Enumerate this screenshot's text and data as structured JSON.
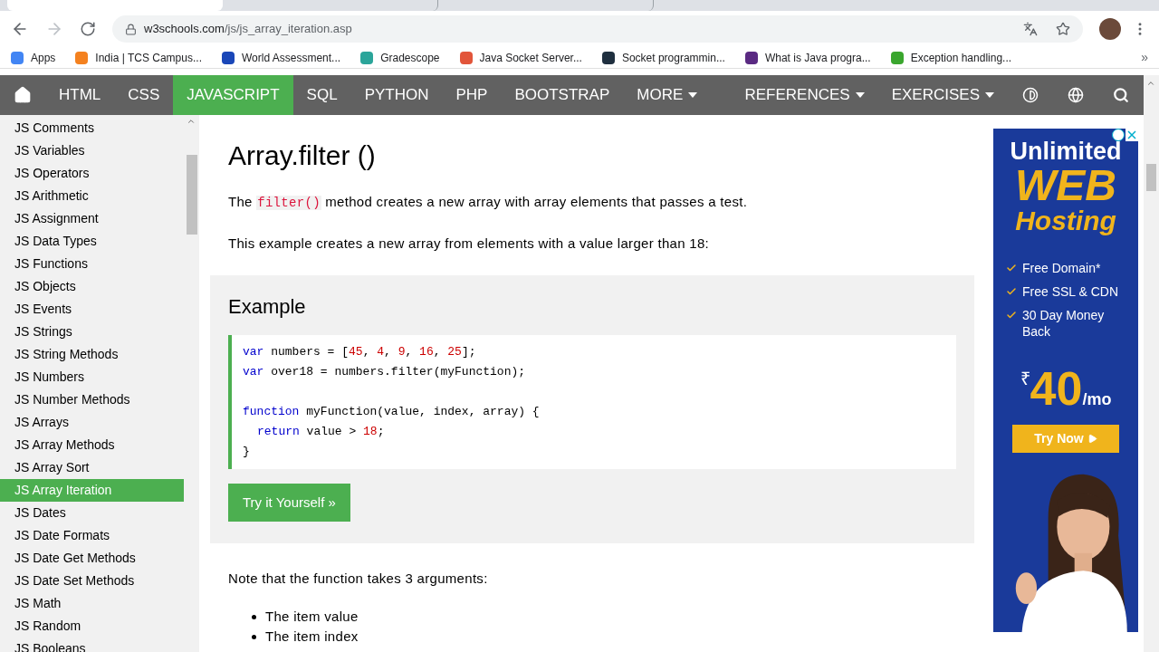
{
  "browser": {
    "tabs": [
      {
        "selected": true
      },
      {
        "selected": false
      },
      {
        "selected": false
      }
    ],
    "url_host": "w3schools.com",
    "url_path": "/js/js_array_iteration.asp",
    "bookmarks": [
      {
        "label": "Apps",
        "color": "#4285f4"
      },
      {
        "label": "India | TCS Campus...",
        "color": "#f4811f"
      },
      {
        "label": "World Assessment...",
        "color": "#1a47b8"
      },
      {
        "label": "Gradescope",
        "color": "#2ba59a"
      },
      {
        "label": "Java Socket Server...",
        "color": "#e2553a"
      },
      {
        "label": "Socket programmin...",
        "color": "#1f2f3f"
      },
      {
        "label": "What is Java progra...",
        "color": "#5a2a82"
      },
      {
        "label": "Exception handling...",
        "color": "#3aa62e"
      }
    ],
    "more": "»"
  },
  "nav": {
    "items": [
      {
        "label": "HTML",
        "selected": false,
        "dropdown": false
      },
      {
        "label": "CSS",
        "selected": false,
        "dropdown": false
      },
      {
        "label": "JAVASCRIPT",
        "selected": true,
        "dropdown": false
      },
      {
        "label": "SQL",
        "selected": false,
        "dropdown": false
      },
      {
        "label": "PYTHON",
        "selected": false,
        "dropdown": false
      },
      {
        "label": "PHP",
        "selected": false,
        "dropdown": false
      },
      {
        "label": "BOOTSTRAP",
        "selected": false,
        "dropdown": false
      },
      {
        "label": "MORE",
        "selected": false,
        "dropdown": true
      }
    ],
    "right_items": [
      {
        "label": "REFERENCES",
        "dropdown": true
      },
      {
        "label": "EXERCISES",
        "dropdown": true
      }
    ]
  },
  "sidebar": {
    "items": [
      {
        "label": "JS Comments",
        "selected": false
      },
      {
        "label": "JS Variables",
        "selected": false
      },
      {
        "label": "JS Operators",
        "selected": false
      },
      {
        "label": "JS Arithmetic",
        "selected": false
      },
      {
        "label": "JS Assignment",
        "selected": false
      },
      {
        "label": "JS Data Types",
        "selected": false
      },
      {
        "label": "JS Functions",
        "selected": false
      },
      {
        "label": "JS Objects",
        "selected": false
      },
      {
        "label": "JS Events",
        "selected": false
      },
      {
        "label": "JS Strings",
        "selected": false
      },
      {
        "label": "JS String Methods",
        "selected": false
      },
      {
        "label": "JS Numbers",
        "selected": false
      },
      {
        "label": "JS Number Methods",
        "selected": false
      },
      {
        "label": "JS Arrays",
        "selected": false
      },
      {
        "label": "JS Array Methods",
        "selected": false
      },
      {
        "label": "JS Array Sort",
        "selected": false
      },
      {
        "label": "JS Array Iteration",
        "selected": true
      },
      {
        "label": "JS Dates",
        "selected": false
      },
      {
        "label": "JS Date Formats",
        "selected": false
      },
      {
        "label": "JS Date Get Methods",
        "selected": false
      },
      {
        "label": "JS Date Set Methods",
        "selected": false
      },
      {
        "label": "JS Math",
        "selected": false
      },
      {
        "label": "JS Random",
        "selected": false
      },
      {
        "label": "JS Booleans",
        "selected": false
      }
    ]
  },
  "article": {
    "heading": "Array.filter ()",
    "intro_before": "The",
    "intro_code": "filter()",
    "intro_after": "method creates a new array with array elements that passes a test.",
    "paragraph": "This example creates a new array from elements with a value larger than 18:",
    "example": {
      "title": "Example",
      "lines": [
        {
          "kind": "code",
          "indented": false,
          "tokens": [
            {
              "kind": "keyword",
              "text": "var"
            },
            {
              "kind": "plain",
              "text": " numbers = ["
            },
            {
              "kind": "number",
              "text": "45"
            },
            {
              "kind": "plain",
              "text": ", "
            },
            {
              "kind": "number",
              "text": "4"
            },
            {
              "kind": "plain",
              "text": ", "
            },
            {
              "kind": "number",
              "text": "9"
            },
            {
              "kind": "plain",
              "text": ", "
            },
            {
              "kind": "number",
              "text": "16"
            },
            {
              "kind": "plain",
              "text": ", "
            },
            {
              "kind": "number",
              "text": "25"
            },
            {
              "kind": "plain",
              "text": "];"
            }
          ]
        },
        {
          "kind": "code",
          "indented": false,
          "tokens": [
            {
              "kind": "keyword",
              "text": "var"
            },
            {
              "kind": "plain",
              "text": " over18 = numbers.filter(myFunction);"
            }
          ]
        },
        {
          "kind": "blank"
        },
        {
          "kind": "code",
          "indented": false,
          "tokens": [
            {
              "kind": "keyword",
              "text": "function"
            },
            {
              "kind": "plain",
              "text": " myFunction(value, index, array) {"
            }
          ]
        },
        {
          "kind": "code",
          "indented": true,
          "tokens": [
            {
              "kind": "keyword",
              "text": "return"
            },
            {
              "kind": "plain",
              "text": " value > "
            },
            {
              "kind": "number",
              "text": "18"
            },
            {
              "kind": "plain",
              "text": ";"
            }
          ]
        },
        {
          "kind": "code",
          "indented": false,
          "tokens": [
            {
              "kind": "plain",
              "text": "}"
            }
          ]
        }
      ],
      "button": "Try it Yourself »"
    },
    "note": "Note that the function takes 3 arguments:",
    "bullets": [
      "The item value",
      "The item index"
    ]
  },
  "ad": {
    "line1": "Unlimited",
    "line2": "WEB",
    "line3": "Hosting",
    "features": [
      "Free Domain*",
      "Free SSL & CDN",
      "30 Day Money Back"
    ],
    "currency": "₹",
    "price": "40",
    "per": "/mo",
    "cta": "Try Now"
  }
}
